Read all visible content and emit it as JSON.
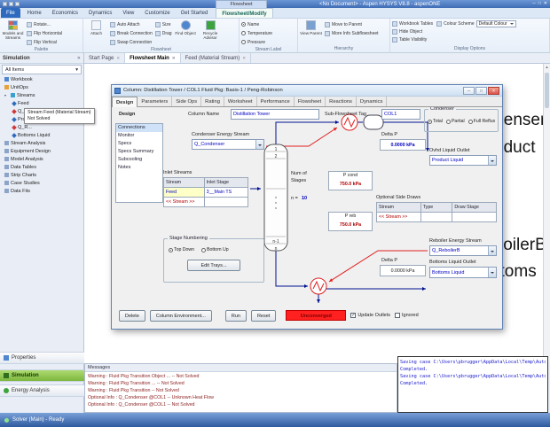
{
  "icons": {
    "close": "✕",
    "dropdown": "▾",
    "expander": "▾",
    "check": "✓",
    "minimize": "─",
    "maximize": "□",
    "up_arrow": "▲",
    "down_arrow": "▼"
  },
  "titlebar": {
    "contextual_group": "Flowsheet",
    "title": "<No Document> - Aspen HYSYS V8.8 - aspenONE"
  },
  "ribbon": {
    "tabs": [
      "File",
      "Home",
      "Economics",
      "Dynamics",
      "View",
      "Customize",
      "Get Started"
    ],
    "contextual_tab": "Flowsheet/Modify",
    "palette_group": {
      "label": "Palette",
      "models_streams": "Models and Streams",
      "rotate": "Rotate...",
      "flip_h": "Flip Horizontal",
      "flip_v": "Flip Vertical"
    },
    "flowsheet_group": {
      "label": "Flowsheet",
      "attach": "Attach",
      "auto_attach": "Auto Attach",
      "break_connection": "Break Connection",
      "swap_connection": "Swap Connection",
      "size": "Size",
      "drag": "Drag",
      "find_object": "Find Object",
      "recycle_advisor": "Recycle Advisor"
    },
    "stream_label_group": {
      "label": "Stream Label",
      "options": [
        "Name",
        "Temperature",
        "Pressure"
      ],
      "selected": "Name"
    },
    "hierarchy_group": {
      "label": "Hierarchy",
      "view_parent": "View Parent",
      "move_to_parent": "Move to Parent",
      "more_info": "More Info Subflowsheet"
    },
    "display_group": {
      "label": "Display Options",
      "workbook_tables": "Workbook Tables",
      "colour_scheme": "Colour Scheme",
      "colour_scheme_value": "Default Colour",
      "hide_object": "Hide Object",
      "table_visibility": "Table Visibility"
    }
  },
  "doc_tabs": {
    "tabs": [
      "Start Page",
      "Flowsheet Main",
      "Feed (Material Stream)"
    ],
    "active": "Flowsheet Main"
  },
  "sidebar": {
    "header": "Simulation",
    "filter": "All Items",
    "tree": [
      {
        "label": "Workbook"
      },
      {
        "label": "UnitOps"
      },
      {
        "label": "Streams"
      },
      {
        "label": "Feed"
      },
      {
        "label": "Q_Condenser"
      },
      {
        "label": "Prod..."
      },
      {
        "label": "Q_R..."
      },
      {
        "label": "Bottoms Liquid"
      },
      {
        "label": "Stream Analysis"
      },
      {
        "label": "Equipment Design"
      },
      {
        "label": "Model Analysis"
      },
      {
        "label": "Data Tables"
      },
      {
        "label": "Strip Charts"
      },
      {
        "label": "Case Studies"
      },
      {
        "label": "Data Fits"
      }
    ],
    "buttons": [
      "Properties",
      "Simulation",
      "Energy Analysis"
    ],
    "active_button": "Simulation"
  },
  "tooltip": {
    "line1": "Stream Feed (Material Stream)",
    "line2": "Not Solved"
  },
  "canvas": {
    "stream_labels": [
      "Q_Condenser",
      "Product",
      "Q_ReboilerB",
      "Bottoms"
    ]
  },
  "dialog": {
    "title": "Column: Distillation Tower / COL1 Fluid Pkg: Basis-1 / Peng-Robinson",
    "tabs": [
      "Design",
      "Parameters",
      "Side Ops",
      "Rating",
      "Worksheet",
      "Performance",
      "Flowsheet",
      "Reactions",
      "Dynamics"
    ],
    "active_tab": "Design",
    "nav_header": "Design",
    "nav_items": [
      "Connections",
      "Monitor",
      "Specs",
      "Specs Summary",
      "Subcooling",
      "Notes"
    ],
    "selected_nav": "Connections",
    "column_name_label": "Column Name",
    "column_name_value": "Distillation Tower",
    "subflowsheet_tag_label": "Sub-Flowsheet Tag",
    "subflowsheet_tag_value": "COL1",
    "condenser": {
      "legend": "Condenser",
      "options": [
        "Total",
        "Partial",
        "Full Reflux"
      ],
      "selected": "Total"
    },
    "condenser_energy_label": "Condenser Energy Stream",
    "condenser_energy_value": "Q_Condenser",
    "delta_p_top_label": "Delta P",
    "delta_p_top_value": "0.0000 kPa",
    "ovhd_label": "Ovhd Liquid Outlet",
    "ovhd_value": "Product Liquid",
    "inlet_streams_label": "Inlet Streams",
    "inlet_table": {
      "headers": [
        "Stream",
        "Inlet Stage"
      ],
      "row": [
        "Feed",
        "3__Main TS"
      ],
      "new_row": "<< Stream >>"
    },
    "num_stages_label1": "Num of",
    "num_stages_label2": "Stages",
    "num_stages_eq": "n =",
    "num_stages_value": "10",
    "p_cond_label": "P cond",
    "p_cond_value": "750.0 kPa",
    "p_reb_label": "P reb",
    "p_reb_value": "750.0 kPa",
    "side_draws_label": "Optional Side Draws",
    "side_draws_table": {
      "headers": [
        "Stream",
        "Type",
        "Draw Stage"
      ],
      "new_row": "<< Stream >>"
    },
    "reboiler_energy_label": "Reboiler Energy Stream",
    "reboiler_energy_value": "Q_ReboilerB",
    "delta_p_bottom_label": "Delta P",
    "delta_p_bottom_value": "0.0000 kPa",
    "bottoms_label": "Bottoms Liquid Outlet",
    "bottoms_value": "Bottoms Liquid",
    "stage_numbering": {
      "legend": "Stage Numbering",
      "options": [
        "Top Down",
        "Bottom Up"
      ],
      "selected": "Top Down",
      "edit_button": "Edit Trays..."
    },
    "tower": {
      "s1": "1",
      "s2": "2",
      "sn1": "n-1",
      "sn": "n"
    },
    "footer": {
      "delete": "Delete",
      "column_environment": "Column Environment...",
      "run": "Run",
      "reset": "Reset",
      "status": "Unconverged",
      "update_outlets": "Update Outlets",
      "update_outlets_checked": true,
      "ignored": "Ignored",
      "ignored_checked": false
    }
  },
  "messages": {
    "title": "Messages",
    "lines": [
      "Warning : Fluid Pkg Transition Object ... -- Not Solved",
      "Warning : Fluid Pkg Transition ... -- Not Solved",
      "Warning : Fluid Pkg Transition -- Not Solved",
      "Optional Info : Q_Condenser @COL1 -- Unknown Heat Flow",
      "Optional Info : Q_Condenser @COL1 -- Not Solved"
    ]
  },
  "console": {
    "lines": [
      "Saving case C:\\Users\\pbrugger\\AppData\\Local\\Temp\\AutoRecovery save of",
      "Completed.",
      "Saving case C:\\Users\\pbrugger\\AppData\\Local\\Temp\\AutoRecovery save of",
      "Completed."
    ]
  },
  "statusbar": {
    "text": "Solver (Main) - Ready"
  },
  "colors": {
    "unconverged_bg": "#ff2020",
    "unconverged_text": "#7a0000",
    "value_blue": "#0000c0",
    "value_red": "#b00000",
    "simulation_green": "#8dc63f",
    "titlebar_blue": "#4f81c7"
  }
}
